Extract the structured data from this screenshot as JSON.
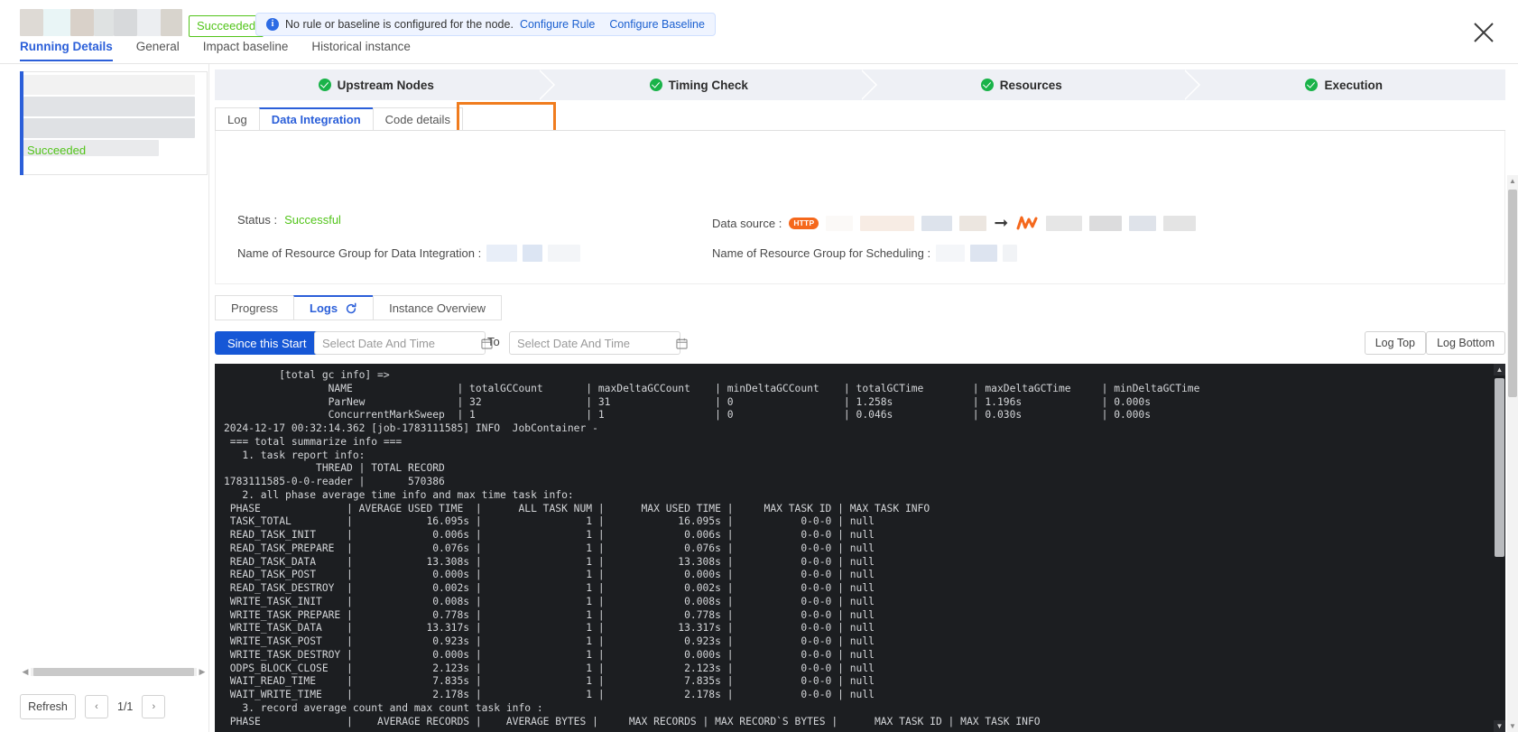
{
  "header": {
    "status_chip": "Succeeded",
    "notice_text": "No rule or baseline is configured for the node.",
    "notice_link1": "Configure Rule",
    "notice_link2": "Configure Baseline",
    "close_icon": "close-icon",
    "tabs": [
      {
        "label": "Running Details",
        "active": true
      },
      {
        "label": "General",
        "active": false
      },
      {
        "label": "Impact baseline",
        "active": false
      },
      {
        "label": "Historical instance",
        "active": false
      }
    ]
  },
  "left_panel": {
    "status": "Succeeded",
    "refresh_label": "Refresh",
    "prev_icon": "chevron-left-icon",
    "next_icon": "chevron-right-icon",
    "page_label": "1/1"
  },
  "steps": [
    {
      "label": "Upstream Nodes",
      "state": "done"
    },
    {
      "label": "Timing Check",
      "state": "done"
    },
    {
      "label": "Resources",
      "state": "done"
    },
    {
      "label": "Execution",
      "state": "done"
    }
  ],
  "inner_tabs": [
    {
      "label": "Log",
      "active": false
    },
    {
      "label": "Data Integration",
      "active": true
    },
    {
      "label": "Code details",
      "active": false
    }
  ],
  "info": {
    "status_label": "Status :",
    "status_value": "Successful",
    "rg_integration_label": "Name of Resource Group for Data Integration :",
    "datasource_label": "Data source :",
    "datasource_badge": "HTTP",
    "rg_scheduling_label": "Name of Resource Group for Scheduling :",
    "arrow_icon": "arrow-right-icon",
    "target_icon": "dataworks-odps-icon"
  },
  "sub_tabs": [
    {
      "label": "Progress",
      "active": false
    },
    {
      "label": "Logs",
      "active": true,
      "icon": "refresh-icon"
    },
    {
      "label": "Instance Overview",
      "active": false
    }
  ],
  "filters": {
    "since_button": "Since this Start",
    "from_placeholder": "Select Date And Time",
    "from_value": "",
    "to_label": "To",
    "to_placeholder": "Select Date And Time",
    "to_value": "",
    "calendar_icon": "calendar-icon",
    "log_top": "Log Top",
    "log_bottom": "Log Bottom"
  },
  "console_log": "         [total gc info] =>\n                 NAME                 | totalGCCount       | maxDeltaGCCount    | minDeltaGCCount    | totalGCTime        | maxDeltaGCTime     | minDeltaGCTime\n                 ParNew               | 32                 | 31                 | 0                  | 1.258s             | 1.196s             | 0.000s\n                 ConcurrentMarkSweep  | 1                  | 1                  | 0                  | 0.046s             | 0.030s             | 0.000s\n2024-12-17 00:32:14.362 [job-1783111585] INFO  JobContainer -\n === total summarize info ===\n   1. task report info:\n               THREAD | TOTAL RECORD\n1783111585-0-0-reader |       570386\n   2. all phase average time info and max time task info:\n PHASE              | AVERAGE USED TIME  |      ALL TASK NUM |      MAX USED TIME |     MAX TASK ID | MAX TASK INFO\n TASK_TOTAL         |            16.095s |                 1 |            16.095s |           0-0-0 | null\n READ_TASK_INIT     |             0.006s |                 1 |             0.006s |           0-0-0 | null\n READ_TASK_PREPARE  |             0.076s |                 1 |             0.076s |           0-0-0 | null\n READ_TASK_DATA     |            13.308s |                 1 |            13.308s |           0-0-0 | null\n READ_TASK_POST     |             0.000s |                 1 |             0.000s |           0-0-0 | null\n READ_TASK_DESTROY  |             0.002s |                 1 |             0.002s |           0-0-0 | null\n WRITE_TASK_INIT    |             0.008s |                 1 |             0.008s |           0-0-0 | null\n WRITE_TASK_PREPARE |             0.778s |                 1 |             0.778s |           0-0-0 | null\n WRITE_TASK_DATA    |            13.317s |                 1 |            13.317s |           0-0-0 | null\n WRITE_TASK_POST    |             0.923s |                 1 |             0.923s |           0-0-0 | null\n WRITE_TASK_DESTROY |             0.000s |                 1 |             0.000s |           0-0-0 | null\n ODPS_BLOCK_CLOSE   |             2.123s |                 1 |             2.123s |           0-0-0 | null\n WAIT_READ_TIME     |             7.835s |                 1 |             7.835s |           0-0-0 | null\n WAIT_WRITE_TIME    |             2.178s |                 1 |             2.178s |           0-0-0 | null\n   3. record average count and max count task info :\n PHASE              |    AVERAGE RECORDS |    AVERAGE BYTES |     MAX RECORDS | MAX RECORD`S BYTES |      MAX TASK ID | MAX TASK INFO",
  "colors": {
    "accent": "#2b5fd9",
    "success": "#52c41a",
    "highlight": "#f07c1e",
    "console_bg": "#1c1e21",
    "primary_button": "#1657d6"
  }
}
